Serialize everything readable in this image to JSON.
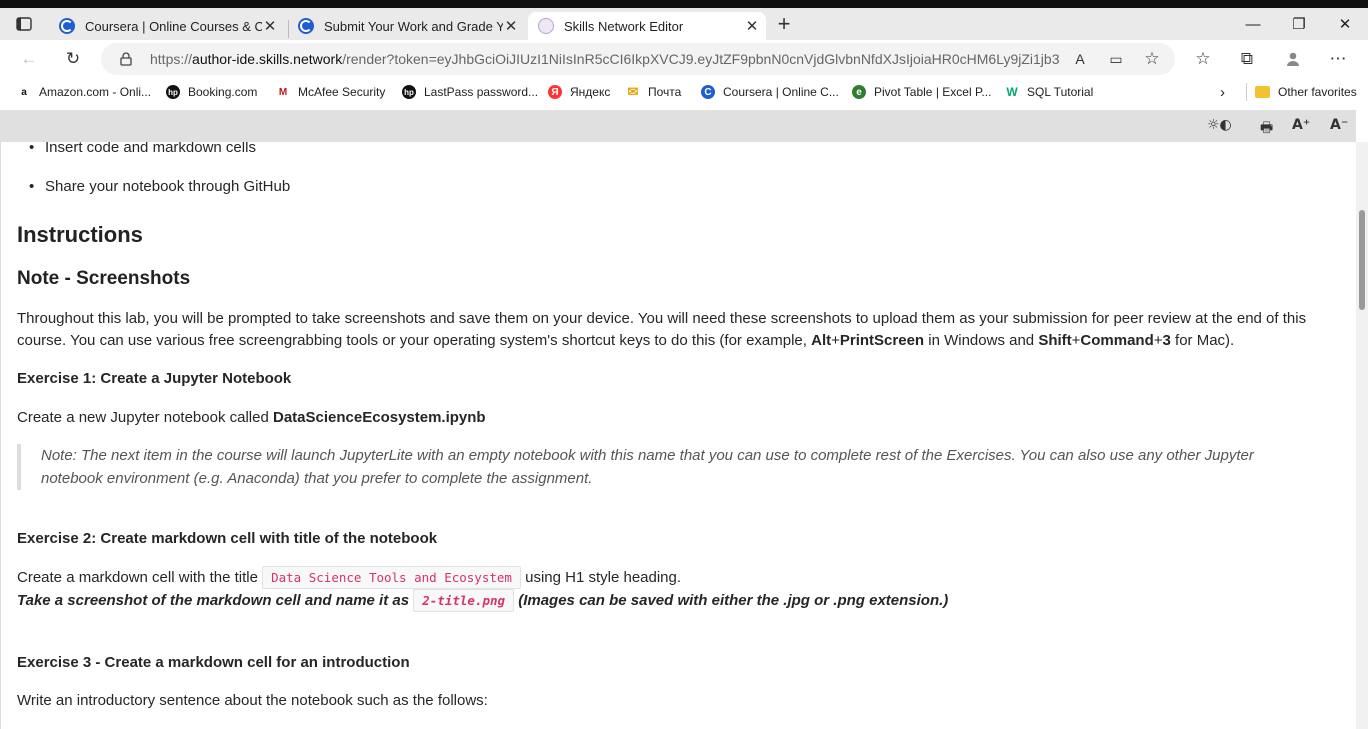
{
  "tabs": [
    {
      "title": "Coursera | Online Courses & Cre",
      "favicon": "coursera-icon"
    },
    {
      "title": "Submit Your Work and Grade You",
      "favicon": "coursera-icon"
    },
    {
      "title": "Skills Network Editor",
      "favicon": "skills-network-icon"
    }
  ],
  "new_tab_label": "+",
  "window": {
    "minimize": "—",
    "restore": "❐",
    "close": "✕"
  },
  "address": {
    "scheme": "https://",
    "host": "author-ide.skills.network",
    "rest": "/render?token=eyJhbGciOiJIUzI1NiIsInR5cCI6IkpXVCJ9.eyJtZF9pbnN0cnVjdGlvbnNfdXJsIjoiaHR0cHM6Ly9jZi1jb3V..."
  },
  "bookmarks": [
    {
      "label": "Amazon.com - Onli...",
      "icon": "amazon-icon",
      "glyph": "a"
    },
    {
      "label": "Booking.com",
      "icon": "hp-icon",
      "glyph": "hp"
    },
    {
      "label": "McAfee Security",
      "icon": "mcafee-icon",
      "glyph": "M"
    },
    {
      "label": "LastPass password...",
      "icon": "hp-icon",
      "glyph": "hp"
    },
    {
      "label": "Яндекс",
      "icon": "yandex-icon",
      "glyph": "Я"
    },
    {
      "label": "Почта",
      "icon": "mail-icon",
      "glyph": "✉"
    },
    {
      "label": "Coursera | Online C...",
      "icon": "coursera-icon",
      "glyph": "C"
    },
    {
      "label": "Pivot Table | Excel P...",
      "icon": "globe-icon",
      "glyph": "e"
    },
    {
      "label": "SQL Tutorial",
      "icon": "w3schools-icon",
      "glyph": "W"
    }
  ],
  "other_favorites": "Other favorites",
  "tools": {
    "theme": "☼◐",
    "print": "🖶",
    "font_up": "A⁺",
    "font_down": "A⁻"
  },
  "doc": {
    "bullet_partial": "Insert code and markdown cells",
    "bullet_share": "Share your notebook through GitHub",
    "h_instructions": "Instructions",
    "h_note": "Note - Screenshots",
    "p1_a": "Throughout this lab, you will be prompted to take screenshots and save them on your device. You will need these screenshots to upload them as your submission for peer review at the end of this course. You can use various free screengrabbing tools or your operating system's shortcut keys to do this (for example, ",
    "p1_alt": "Alt",
    "p1_plus1": "+",
    "p1_printscreen": "PrintScreen",
    "p1_mid": " in Windows and ",
    "p1_shift": "Shift",
    "p1_plus2": "+",
    "p1_command": "Command",
    "p1_plus3": "+",
    "p1_three": "3",
    "p1_end": " for Mac).",
    "ex1_title": "Exercise 1: Create a Jupyter Notebook",
    "ex1_text": "Create a new Jupyter notebook called ",
    "ex1_name": "DataScienceEcosystem.ipynb",
    "note_quote": "Note: The next item in the course will launch JupyterLite with an empty notebook with this name that you can use to complete rest of the Exercises. You can also use any other Jupyter notebook environment (e.g. Anaconda) that you prefer to complete the assignment.",
    "ex2_title": "Exercise 2: Create markdown cell with title of the notebook",
    "ex2_text_a": "Create a markdown cell with the title ",
    "ex2_code": "Data Science Tools and Ecosystem",
    "ex2_text_b": " using H1 style heading.",
    "ex2_shot_a": "Take a screenshot of the markdown cell and name it as ",
    "ex2_shot_code": "2-title.png",
    "ex2_shot_b": " (Images can be saved with either the .jpg or .png extension.)",
    "ex3_title": "Exercise 3 - Create a markdown cell for an introduction",
    "ex3_text": "Write an introductory sentence about the notebook such as the follows:"
  }
}
